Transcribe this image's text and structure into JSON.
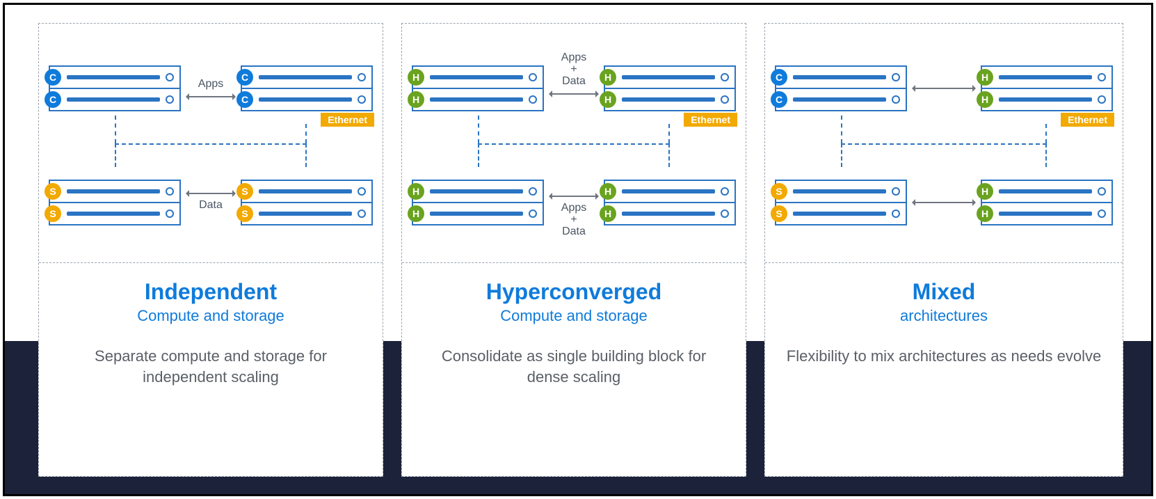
{
  "labels": {
    "ethernet": "Ethernet",
    "apps": "Apps",
    "data": "Data",
    "apps_plus_data": "Apps\n+\nData",
    "badge_c": "C",
    "badge_s": "S",
    "badge_h": "H"
  },
  "panels": [
    {
      "id": "independent",
      "title": "Independent",
      "subtitle": "Compute and storage",
      "description": "Separate compute and storage for independent scaling",
      "top_label": "Apps",
      "bottom_label": "Data",
      "top_left_badges": [
        "C",
        "C"
      ],
      "top_right_badges": [
        "C",
        "C"
      ],
      "bottom_left_badges": [
        "S",
        "S"
      ],
      "bottom_right_badges": [
        "S",
        "S"
      ],
      "ethernet_tag": true
    },
    {
      "id": "hyperconverged",
      "title": "Hyperconverged",
      "subtitle": "Compute and storage",
      "description": "Consolidate as single building block for dense scaling",
      "top_label": "Apps\n+\nData",
      "bottom_label": "Apps\n+\nData",
      "top_left_badges": [
        "H",
        "H"
      ],
      "top_right_badges": [
        "H",
        "H"
      ],
      "bottom_left_badges": [
        "H",
        "H"
      ],
      "bottom_right_badges": [
        "H",
        "H"
      ],
      "ethernet_tag": true
    },
    {
      "id": "mixed",
      "title": "Mixed",
      "subtitle": "architectures",
      "description": "Flexibility to mix architectures as needs evolve",
      "top_label": "",
      "bottom_label": "",
      "top_left_badges": [
        "C",
        "C"
      ],
      "top_right_badges": [
        "H",
        "H"
      ],
      "bottom_left_badges": [
        "S",
        "S"
      ],
      "bottom_right_badges": [
        "H",
        "H"
      ],
      "ethernet_tag": true
    }
  ]
}
